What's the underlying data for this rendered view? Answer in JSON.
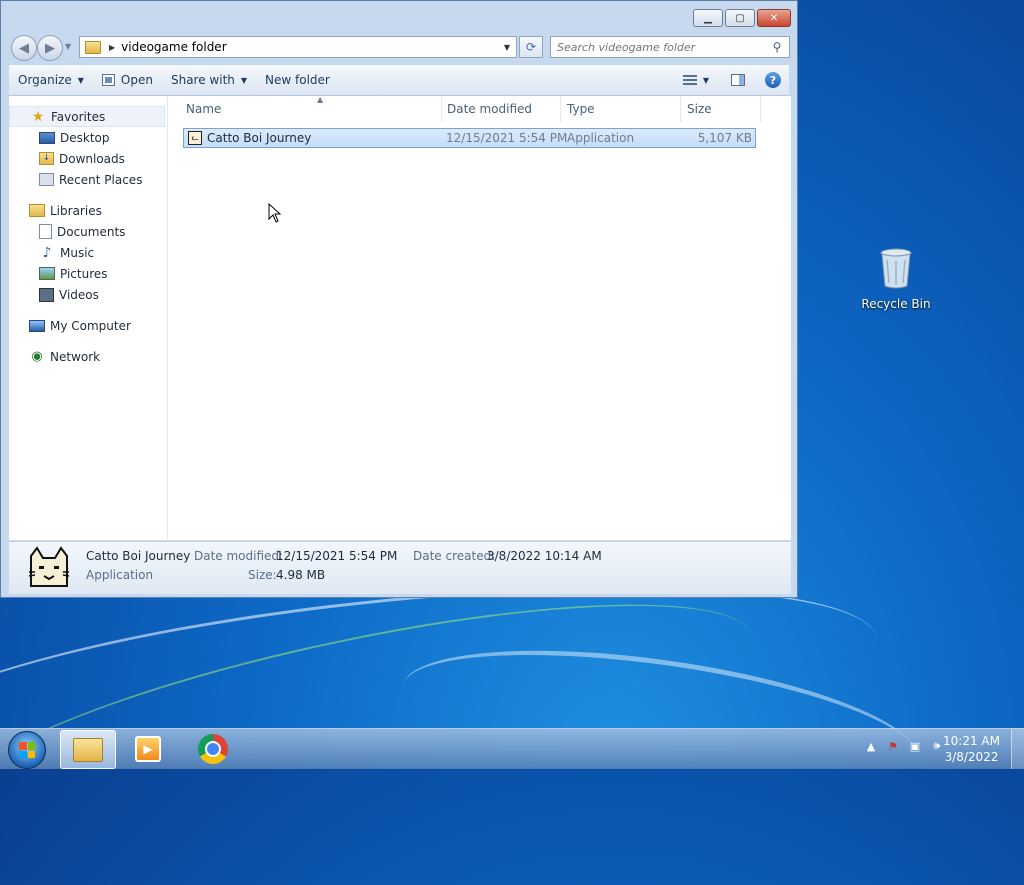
{
  "window": {
    "caption_buttons": {
      "minimize": "▁",
      "maximize": "▢",
      "close": "✕"
    },
    "address": {
      "path": "videogame folder",
      "search_placeholder": "Search videogame folder"
    },
    "toolbar": {
      "organize": "Organize",
      "open": "Open",
      "share_with": "Share with",
      "new_folder": "New folder",
      "help": "?"
    },
    "nav": {
      "favorites": {
        "label": "Favorites",
        "items": [
          {
            "label": "Desktop"
          },
          {
            "label": "Downloads"
          },
          {
            "label": "Recent Places"
          }
        ]
      },
      "libraries": {
        "label": "Libraries",
        "items": [
          {
            "label": "Documents"
          },
          {
            "label": "Music"
          },
          {
            "label": "Pictures"
          },
          {
            "label": "Videos"
          }
        ]
      },
      "computer": {
        "label": "My Computer"
      },
      "network": {
        "label": "Network"
      }
    },
    "columns": {
      "name": "Name",
      "date_modified": "Date modified",
      "type": "Type",
      "size": "Size"
    },
    "files": [
      {
        "name": "Catto Boi Journey",
        "date_modified": "12/15/2021 5:54 PM",
        "type": "Application",
        "size": "5,107 KB"
      }
    ],
    "details": {
      "name": "Catto Boi Journey",
      "type": "Application",
      "date_modified_label": "Date modified:",
      "date_modified": "12/15/2021 5:54 PM",
      "date_created_label": "Date created:",
      "date_created": "3/8/2022 10:14 AM",
      "size_label": "Size:",
      "size": "4.98 MB"
    }
  },
  "desktop": {
    "recycle_bin": "Recycle Bin"
  },
  "taskbar": {
    "time": "10:21 AM",
    "date": "3/8/2022"
  },
  "colors": {
    "selection": "#cce4fb",
    "window_frame": "#c7d9ee",
    "desktop": "#0d6ac7"
  }
}
